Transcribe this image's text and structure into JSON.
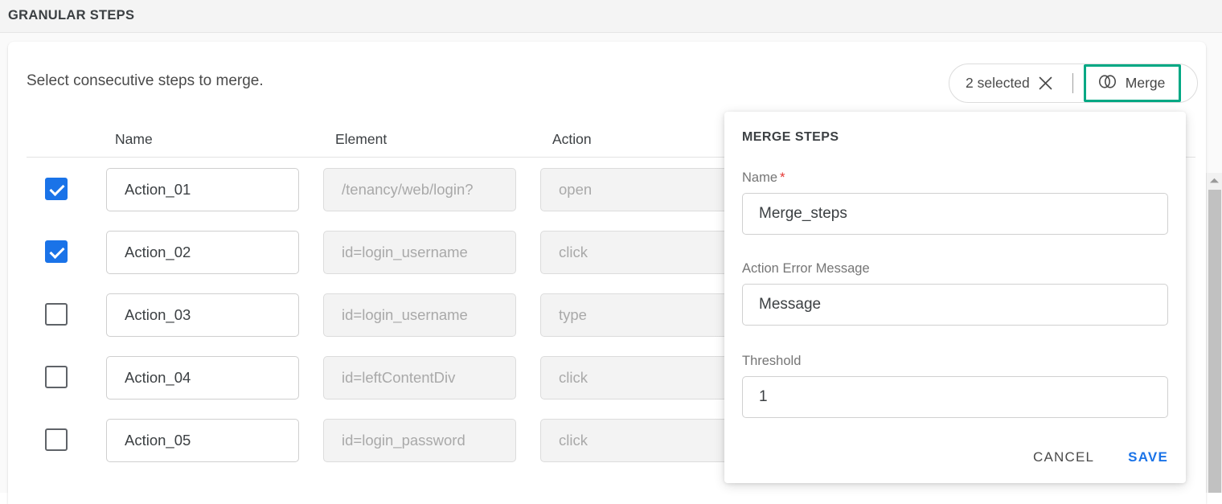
{
  "header": {
    "title": "GRANULAR STEPS"
  },
  "card": {
    "subtitle": "Select consecutive steps to merge."
  },
  "selection_toolbar": {
    "selected_count_label": "2 selected",
    "clear_icon": "close-icon",
    "divider": "|",
    "merge_icon": "link-chain-icon",
    "merge_label": "Merge",
    "merge_highlight_color": "#00a884"
  },
  "table": {
    "columns": [
      "Name",
      "Element",
      "Action"
    ],
    "rows": [
      {
        "checked": true,
        "name": "Action_01",
        "element": "/tenancy/web/login?",
        "action": "open"
      },
      {
        "checked": true,
        "name": "Action_02",
        "element": "id=login_username",
        "action": "click"
      },
      {
        "checked": false,
        "name": "Action_03",
        "element": "id=login_username",
        "action": "type"
      },
      {
        "checked": false,
        "name": "Action_04",
        "element": "id=leftContentDiv",
        "action": "click"
      },
      {
        "checked": false,
        "name": "Action_05",
        "element": "id=login_password",
        "action": "click"
      }
    ]
  },
  "merge_panel": {
    "title": "MERGE STEPS",
    "fields": {
      "name": {
        "label": "Name",
        "required_marker": "*",
        "value": "Merge_steps"
      },
      "error_message": {
        "label": "Action Error Message",
        "value": "Message"
      },
      "threshold": {
        "label": "Threshold",
        "value": "1"
      }
    },
    "cancel_label": "CANCEL",
    "save_label": "SAVE",
    "save_color": "#1a73e8"
  },
  "scrollbar": {
    "up_arrow_icon": "chevron-up-icon"
  }
}
